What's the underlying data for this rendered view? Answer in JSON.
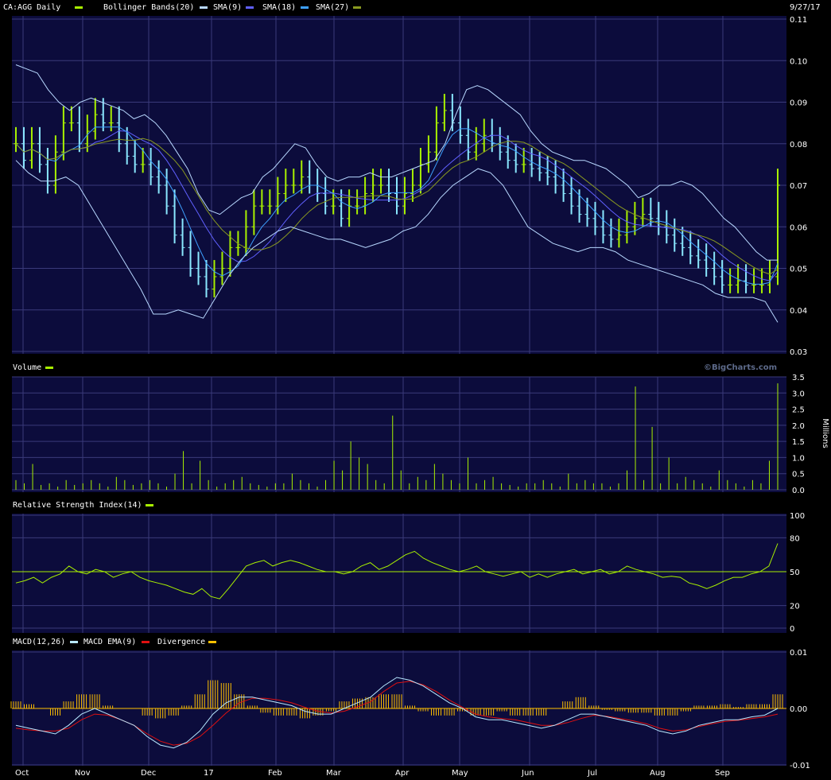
{
  "colors": {
    "background": "#000000",
    "panel": "#0c0c3c",
    "grid": "#3a3a7a",
    "price_bar": "#a8f000",
    "price_bar_down": "#8ae8ff",
    "bollinger": "#b8d8ff",
    "sma9": "#6060ff",
    "sma18": "#3da0ff",
    "sma27": "#8a9a20",
    "volume": "#a8f000",
    "rsi": "#a8f000",
    "macd": "#b8e8ff",
    "macd_ema": "#e01010",
    "divergence": "#ffc000",
    "text": "#ffffff"
  },
  "header": {
    "symbol": "CA:AGG Daily",
    "ind1": "Bollinger Bands(20)",
    "ind2": "SMA(9)",
    "ind3": "SMA(18)",
    "ind4": "SMA(27)",
    "date": "9/27/17"
  },
  "volume_panel": {
    "title": "Volume",
    "watermark": "©BigCharts.com",
    "unit": "Millions"
  },
  "rsi_panel": {
    "title": "Relative Strength Index(14)"
  },
  "macd_panel": {
    "t1": "MACD(12,26)",
    "t2": "MACD EMA(9)",
    "t3": "Divergence"
  },
  "chart_data": [
    {
      "type": "line",
      "panel": "price",
      "x_labels": [
        "Oct",
        "Nov",
        "Dec",
        "17",
        "Feb",
        "Mar",
        "Apr",
        "May",
        "Jun",
        "Jul",
        "Aug",
        "Sep"
      ],
      "y_ticks": [
        "0.11",
        "0.10",
        "0.09",
        "0.08",
        "0.07",
        "0.06",
        "0.05",
        "0.04",
        "0.03"
      ],
      "ylim": [
        0.03,
        0.11
      ],
      "price_close": [
        0.08,
        0.076,
        0.08,
        0.075,
        0.07,
        0.078,
        0.085,
        0.085,
        0.08,
        0.083,
        0.087,
        0.085,
        0.085,
        0.08,
        0.077,
        0.075,
        0.075,
        0.072,
        0.07,
        0.065,
        0.058,
        0.055,
        0.05,
        0.048,
        0.045,
        0.048,
        0.05,
        0.055,
        0.055,
        0.06,
        0.065,
        0.065,
        0.065,
        0.068,
        0.07,
        0.07,
        0.072,
        0.07,
        0.068,
        0.065,
        0.065,
        0.062,
        0.065,
        0.065,
        0.068,
        0.07,
        0.07,
        0.068,
        0.065,
        0.068,
        0.07,
        0.075,
        0.078,
        0.085,
        0.088,
        0.085,
        0.082,
        0.078,
        0.08,
        0.082,
        0.08,
        0.078,
        0.076,
        0.075,
        0.075,
        0.074,
        0.073,
        0.072,
        0.07,
        0.068,
        0.065,
        0.063,
        0.062,
        0.06,
        0.058,
        0.057,
        0.058,
        0.06,
        0.062,
        0.063,
        0.062,
        0.06,
        0.058,
        0.056,
        0.055,
        0.053,
        0.052,
        0.05,
        0.048,
        0.046,
        0.046,
        0.047,
        0.046,
        0.046,
        0.046,
        0.048,
        0.07
      ],
      "bollinger_upper": [
        0.099,
        0.098,
        0.097,
        0.093,
        0.09,
        0.088,
        0.09,
        0.091,
        0.09,
        0.089,
        0.088,
        0.086,
        0.087,
        0.085,
        0.082,
        0.078,
        0.074,
        0.068,
        0.064,
        0.063,
        0.065,
        0.067,
        0.068,
        0.072,
        0.074,
        0.077,
        0.08,
        0.079,
        0.075,
        0.072,
        0.071,
        0.072,
        0.072,
        0.073,
        0.072,
        0.072,
        0.073,
        0.074,
        0.075,
        0.076,
        0.08,
        0.087,
        0.093,
        0.094,
        0.093,
        0.091,
        0.089,
        0.087,
        0.083,
        0.08,
        0.078,
        0.077,
        0.076,
        0.076,
        0.075,
        0.074,
        0.072,
        0.07,
        0.067,
        0.068,
        0.07,
        0.07,
        0.071,
        0.07,
        0.068,
        0.065,
        0.062,
        0.06,
        0.057,
        0.054,
        0.052,
        0.052
      ],
      "bollinger_lower": [
        0.076,
        0.073,
        0.071,
        0.071,
        0.072,
        0.07,
        0.065,
        0.06,
        0.055,
        0.05,
        0.045,
        0.039,
        0.039,
        0.04,
        0.039,
        0.038,
        0.043,
        0.048,
        0.052,
        0.055,
        0.057,
        0.059,
        0.06,
        0.059,
        0.058,
        0.057,
        0.057,
        0.056,
        0.055,
        0.056,
        0.057,
        0.059,
        0.06,
        0.063,
        0.067,
        0.07,
        0.072,
        0.074,
        0.073,
        0.07,
        0.065,
        0.06,
        0.058,
        0.056,
        0.055,
        0.054,
        0.055,
        0.055,
        0.054,
        0.052,
        0.051,
        0.05,
        0.049,
        0.048,
        0.047,
        0.046,
        0.044,
        0.043,
        0.043,
        0.043,
        0.042,
        0.037
      ],
      "series_names": [
        "Bollinger Bands(20)",
        "SMA(9)",
        "SMA(18)",
        "SMA(27)"
      ]
    },
    {
      "type": "bar",
      "panel": "volume",
      "y_ticks": [
        "3.5",
        "3.0",
        "2.5",
        "2.0",
        "1.5",
        "1.0",
        "0.5",
        "0.0"
      ],
      "ylim": [
        0,
        3.5
      ],
      "ylabel": "Millions",
      "values": [
        0.3,
        0.2,
        0.8,
        0.15,
        0.2,
        0.1,
        0.3,
        0.15,
        0.2,
        0.3,
        0.2,
        0.1,
        0.4,
        0.3,
        0.15,
        0.2,
        0.3,
        0.2,
        0.1,
        0.5,
        1.2,
        0.2,
        0.9,
        0.3,
        0.1,
        0.2,
        0.3,
        0.4,
        0.2,
        0.15,
        0.1,
        0.2,
        0.2,
        0.5,
        0.3,
        0.2,
        0.1,
        0.3,
        0.9,
        0.6,
        1.5,
        1.0,
        0.8,
        0.3,
        0.2,
        2.3,
        0.6,
        0.2,
        0.4,
        0.3,
        0.8,
        0.5,
        0.3,
        0.2,
        1.0,
        0.2,
        0.3,
        0.4,
        0.2,
        0.15,
        0.1,
        0.2,
        0.2,
        0.3,
        0.2,
        0.1,
        0.5,
        0.2,
        0.3,
        0.2,
        0.2,
        0.1,
        0.2,
        0.6,
        3.2,
        0.3,
        1.95,
        0.2,
        1.0,
        0.2,
        0.4,
        0.3,
        0.2,
        0.1,
        0.6,
        0.3,
        0.2,
        0.1,
        0.3,
        0.2,
        0.9,
        3.3
      ]
    },
    {
      "type": "line",
      "panel": "rsi",
      "y_ticks": [
        "100",
        "80",
        "50",
        "20",
        "0"
      ],
      "ylim": [
        0,
        100
      ],
      "reference_line": 50,
      "values": [
        40,
        42,
        45,
        40,
        45,
        48,
        55,
        50,
        48,
        52,
        50,
        45,
        48,
        50,
        45,
        42,
        40,
        38,
        35,
        32,
        30,
        35,
        28,
        26,
        35,
        45,
        55,
        58,
        60,
        55,
        58,
        60,
        58,
        55,
        52,
        50,
        50,
        48,
        50,
        55,
        58,
        52,
        55,
        60,
        65,
        68,
        62,
        58,
        55,
        52,
        50,
        52,
        55,
        50,
        48,
        46,
        48,
        50,
        45,
        48,
        45,
        48,
        50,
        52,
        48,
        50,
        52,
        48,
        50,
        55,
        52,
        50,
        48,
        45,
        46,
        45,
        40,
        38,
        35,
        38,
        42,
        45,
        45,
        48,
        50,
        55,
        75
      ]
    },
    {
      "type": "line",
      "panel": "macd",
      "y_ticks": [
        "0.01",
        "0.00",
        "-0.01"
      ],
      "ylim": [
        -0.01,
        0.01
      ],
      "macd": [
        -0.003,
        -0.0035,
        -0.004,
        -0.0045,
        -0.003,
        -0.001,
        0.0,
        -0.001,
        -0.002,
        -0.003,
        -0.005,
        -0.0065,
        -0.007,
        -0.006,
        -0.004,
        -0.001,
        0.001,
        0.002,
        0.002,
        0.0015,
        0.001,
        0.0005,
        -0.0005,
        -0.001,
        -0.001,
        0.0,
        0.001,
        0.002,
        0.004,
        0.0055,
        0.005,
        0.004,
        0.0025,
        0.001,
        0.0,
        -0.0015,
        -0.002,
        -0.002,
        -0.0025,
        -0.003,
        -0.0035,
        -0.003,
        -0.002,
        -0.001,
        -0.001,
        -0.0015,
        -0.002,
        -0.0025,
        -0.003,
        -0.004,
        -0.0045,
        -0.004,
        -0.003,
        -0.0025,
        -0.002,
        -0.002,
        -0.0015,
        -0.0012,
        0.0
      ],
      "macd_ema": [
        -0.0035,
        -0.0038,
        -0.004,
        -0.004,
        -0.0035,
        -0.002,
        -0.001,
        -0.0012,
        -0.002,
        -0.003,
        -0.0045,
        -0.0058,
        -0.0065,
        -0.0062,
        -0.005,
        -0.003,
        -0.0008,
        0.001,
        0.0018,
        0.0018,
        0.0015,
        0.001,
        0.0002,
        -0.0005,
        -0.0008,
        -0.0005,
        0.0003,
        0.0012,
        0.003,
        0.0045,
        0.0048,
        0.0042,
        0.003,
        0.0015,
        0.0002,
        -0.001,
        -0.0015,
        -0.0018,
        -0.002,
        -0.0025,
        -0.003,
        -0.003,
        -0.0025,
        -0.0018,
        -0.0012,
        -0.0014,
        -0.0018,
        -0.0022,
        -0.0027,
        -0.0035,
        -0.004,
        -0.0038,
        -0.0032,
        -0.0027,
        -0.0023,
        -0.0021,
        -0.0018,
        -0.0015,
        -0.001
      ],
      "series_names": [
        "MACD(12,26)",
        "MACD EMA(9)",
        "Divergence"
      ]
    }
  ]
}
